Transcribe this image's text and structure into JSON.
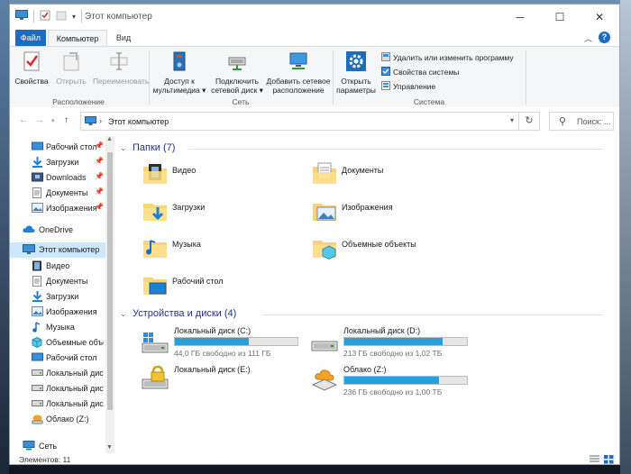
{
  "window": {
    "title": "Этот компьютер",
    "controls": {
      "minimize": "─",
      "maximize": "☐",
      "close": "✕"
    }
  },
  "ribbon": {
    "tabs": [
      {
        "label": "Файл"
      },
      {
        "label": "Компьютер"
      },
      {
        "label": "Вид"
      }
    ],
    "help": "?",
    "groups": {
      "location": {
        "label": "Расположение",
        "buttons": [
          "Свойства",
          "Открыть",
          "Переименовать"
        ]
      },
      "network": {
        "label": "Сеть",
        "buttons": [
          {
            "line1": "Доступ к",
            "line2": "мультимедиа ▾"
          },
          {
            "line1": "Подключить",
            "line2": "сетевой диск ▾"
          },
          {
            "line1": "Добавить сетевое",
            "line2": "расположение"
          }
        ]
      },
      "system": {
        "label": "Система",
        "open_params": {
          "line1": "Открыть",
          "line2": "параметры"
        },
        "items": [
          "Удалить или изменить программу",
          "Свойства системы",
          "Управление"
        ]
      }
    }
  },
  "address": {
    "path": "Этот компьютер",
    "search_placeholder": "Поиск: ..."
  },
  "nav": {
    "quick_access": [
      {
        "label": "Рабочий стол",
        "icon": "desktop-icon",
        "pinned": true
      },
      {
        "label": "Загрузки",
        "icon": "download-icon",
        "pinned": true
      },
      {
        "label": "Downloads",
        "icon": "folder-download-icon",
        "pinned": true
      },
      {
        "label": "Документы",
        "icon": "documents-icon",
        "pinned": true
      },
      {
        "label": "Изображения",
        "icon": "pictures-icon",
        "pinned": true
      }
    ],
    "onedrive": "OneDrive",
    "this_pc": "Этот компьютер",
    "pc_items": [
      {
        "label": "Видео",
        "icon": "video-icon"
      },
      {
        "label": "Документы",
        "icon": "documents-icon"
      },
      {
        "label": "Загрузки",
        "icon": "download-icon"
      },
      {
        "label": "Изображения",
        "icon": "pictures-icon"
      },
      {
        "label": "Музыка",
        "icon": "music-icon"
      },
      {
        "label": "Объемные объекты",
        "icon": "3d-objects-icon"
      },
      {
        "label": "Рабочий стол",
        "icon": "desktop-icon"
      },
      {
        "label": "Локальный диск (C:)",
        "icon": "drive-icon"
      },
      {
        "label": "Локальный диск (D:)",
        "icon": "drive-icon"
      },
      {
        "label": "Локальный диск (E:)",
        "icon": "drive-icon"
      },
      {
        "label": "Облако (Z:)",
        "icon": "cloud-drive-icon"
      }
    ],
    "network": "Сеть"
  },
  "content": {
    "folders_header": "Папки (7)",
    "folders": [
      {
        "label": "Видео",
        "icon": "video-folder-icon"
      },
      {
        "label": "Документы",
        "icon": "documents-folder-icon"
      },
      {
        "label": "Загрузки",
        "icon": "downloads-folder-icon"
      },
      {
        "label": "Изображения",
        "icon": "pictures-folder-icon"
      },
      {
        "label": "Музыка",
        "icon": "music-folder-icon"
      },
      {
        "label": "Объемные объекты",
        "icon": "3d-objects-folder-icon"
      },
      {
        "label": "Рабочий стол",
        "icon": "desktop-folder-icon"
      }
    ],
    "drives_header": "Устройства и диски (4)",
    "drives": [
      {
        "label": "Локальный диск (C:)",
        "free": "44,0 ГБ свободно из 111 ГБ",
        "used_fraction": 0.6,
        "icon": "windows-drive-icon"
      },
      {
        "label": "Локальный диск (D:)",
        "free": "213 ГБ свободно из 1,02 ТБ",
        "used_fraction": 0.8,
        "icon": "drive-icon"
      },
      {
        "label": "Локальный диск (E:)",
        "free": "",
        "used_fraction": null,
        "icon": "locked-drive-icon"
      },
      {
        "label": "Облако (Z:)",
        "free": "236 ГБ свободно из 1,00 ТБ",
        "used_fraction": 0.77,
        "icon": "cloud-drive-icon"
      }
    ]
  },
  "status": {
    "items_count": "Элементов: 11"
  },
  "colors": {
    "accent": "#1e6cc0",
    "bar_fill": "#26a0da",
    "header_text": "#1e3287",
    "selection": "#cce8ff"
  }
}
